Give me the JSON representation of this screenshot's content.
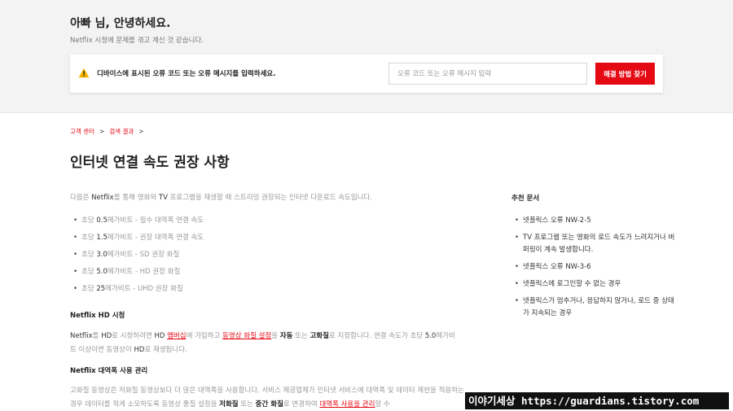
{
  "header": {
    "greeting": "아빠 님, 안녕하세요.",
    "subtitle": "Netflix 시청에 문제를 겪고 계신 것 같습니다.",
    "prompt": "디바이스에 표시된 오류 코드 또는 오류 메시지를 입력하세요.",
    "search_placeholder": "오류 코드 또는 오류 메시지 입력",
    "search_button": "해결 방법 찾기",
    "icon": "warning-icon"
  },
  "breadcrumb": {
    "items": [
      "고객 센터",
      "검색 결과"
    ],
    "separator": ">"
  },
  "article": {
    "title": "인터넷 연결 속도 권장 사항",
    "intro": {
      "t1": "다음은 ",
      "netflix": "Netflix",
      "t2": "를 통해 영화와 ",
      "tv": "TV",
      "t3": " 프로그램을 재생할 때 스트리밍 권장되는 인터넷 다운로드 속도입니다."
    },
    "speeds": [
      {
        "pre": "초당 ",
        "num": "0.5",
        "mid": "메가비트 - ",
        "label": "필수 대역폭 연결 속도"
      },
      {
        "pre": "초당 ",
        "num": "1.5",
        "mid": "메가비트 - ",
        "label": "권장 대역폭 연결 속도"
      },
      {
        "pre": "초당 ",
        "num": "3.0",
        "mid": "메가비트 - ",
        "label": "SD 권장 화질"
      },
      {
        "pre": "초당 ",
        "num": "5.0",
        "mid": "메가비트 - ",
        "label": "HD 권장 화질"
      },
      {
        "pre": "초당 ",
        "num": "25",
        "mid": "메가비트 - ",
        "label": "UHD 권장 화질"
      }
    ],
    "hd_heading": "Netflix HD 시청",
    "hd": {
      "p1": "Netflix",
      "p2": "를 ",
      "p3": "HD",
      "p4": "로 시청하려면 ",
      "p5": "HD",
      "p6": " ",
      "link1": "멤버십",
      "p7": "에 가입하고 ",
      "link2": "동영상 화질 설정",
      "p8": "을 ",
      "b1": "자동",
      "p9": " 또는 ",
      "b2": "고화질",
      "p10": "로 지정합니다. 연결 속도가 초당 ",
      "p11": "5.0",
      "p12": "메가비트 이상이면 동영상이 ",
      "p13": "HD",
      "p14": "로 재생됩니다."
    },
    "bw_heading": "Netflix 대역폭 사용 관리",
    "bw": {
      "p1": "고화질 동영상은 저화질 동영상보다 더 많은 대역폭을 사용합니다. 서비스 제공업체가 인터넷 서비스에 대역폭 및 데이터 제한을 적용하는 경우 데이터를 적게 소모하도록 동영상 품질 설정을 ",
      "b1": "저화질",
      "p2": " 또는 ",
      "b2": "중간 화질",
      "p3": "로 변경하여 ",
      "link": "대역폭 사용을 관리",
      "p4": "할 수"
    }
  },
  "sidebar": {
    "title": "추천 문서",
    "items": [
      "넷플릭스 오류 NW-2-5",
      "TV 프로그램 또는 영화의 로드 속도가 느려지거나 버퍼링이 계속 발생합니다.",
      "넷플릭스 오류 NW-3-6",
      "넷플릭스에 로그인할 수 없는 경우",
      "넷플릭스가 멈추거나, 응답하지 않거나, 로드 중 상태가 지속되는 경우"
    ]
  },
  "watermark": "이야기세상 https://guardians.tistory.com",
  "colors": {
    "accent": "#e50914",
    "header_bg": "#f3f3f3",
    "muted_text": "#999999"
  }
}
